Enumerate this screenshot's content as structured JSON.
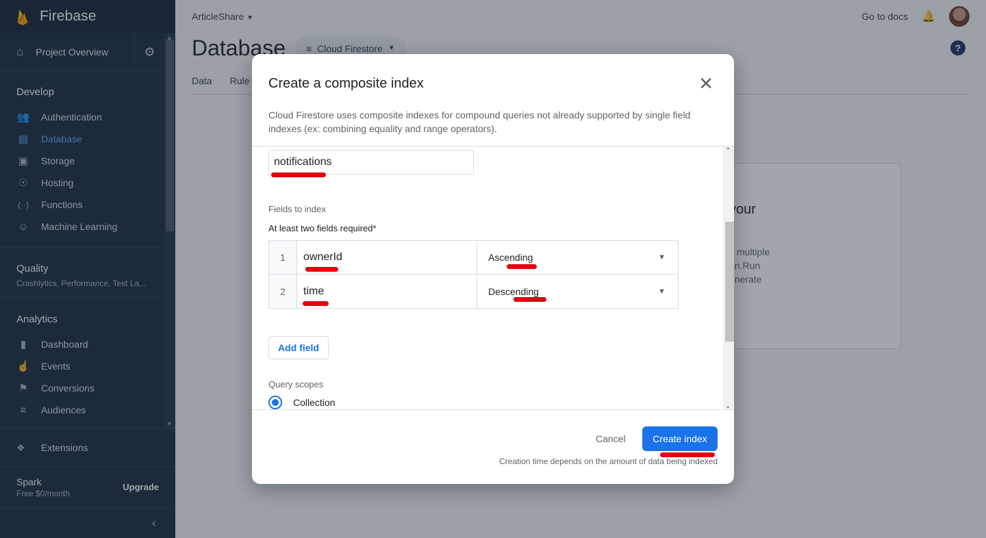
{
  "sidebar": {
    "brand": "Firebase",
    "overview": "Project Overview",
    "develop": {
      "title": "Develop",
      "items": [
        {
          "label": "Authentication",
          "icon": "people-icon"
        },
        {
          "label": "Database",
          "icon": "database-icon",
          "active": true
        },
        {
          "label": "Storage",
          "icon": "folder-image-icon"
        },
        {
          "label": "Hosting",
          "icon": "globe-icon"
        },
        {
          "label": "Functions",
          "icon": "functions-icon"
        },
        {
          "label": "Machine Learning",
          "icon": "robot-icon"
        }
      ]
    },
    "quality": {
      "title": "Quality",
      "subtitle": "Crashlytics, Performance, Test La..."
    },
    "analytics": {
      "title": "Analytics",
      "items": [
        {
          "label": "Dashboard",
          "icon": "bar-chart-icon"
        },
        {
          "label": "Events",
          "icon": "touch-icon"
        },
        {
          "label": "Conversions",
          "icon": "flag-icon"
        },
        {
          "label": "Audiences",
          "icon": "list-icon"
        }
      ]
    },
    "extensions": "Extensions",
    "plan": {
      "name": "Spark",
      "price": "Free $0/month",
      "upgrade": "Upgrade"
    }
  },
  "header": {
    "project": "ArticleShare",
    "docs": "Go to docs",
    "page_title": "Database",
    "db_selector": "Cloud Firestore",
    "tabs": [
      "Data",
      "Rule"
    ]
  },
  "background_card": {
    "heading": "your",
    "lines": [
      "s multiple",
      "on.Run",
      "enerate"
    ]
  },
  "dialog": {
    "title": "Create a composite index",
    "description": "Cloud Firestore uses composite indexes for compound queries not already supported by single field indexes (ex: combining equality and range operators).",
    "collection_id": "notifications",
    "fields_label": "Fields to index",
    "required_label": "At least two fields required*",
    "fields": [
      {
        "num": "1",
        "name": "ownerId",
        "order": "Ascending"
      },
      {
        "num": "2",
        "name": "time",
        "order": "Descending"
      }
    ],
    "add_field": "Add field",
    "scope_label": "Query scopes",
    "scope_selected": "Collection",
    "cancel": "Cancel",
    "create": "Create index",
    "footnote": "Creation time depends on the amount of data being indexed"
  },
  "colors": {
    "accent": "#1a73e8",
    "sidebar_bg": "#1b2a3f",
    "annotation_red": "#e3000f"
  }
}
